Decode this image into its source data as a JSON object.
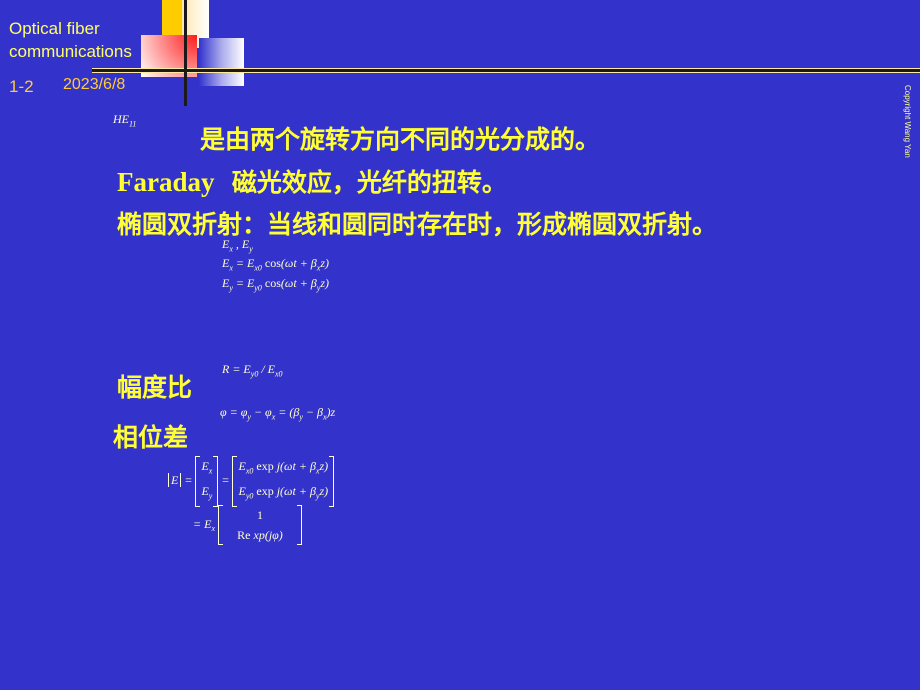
{
  "header": {
    "title_line1": "Optical fiber",
    "title_line2": "communications",
    "slide_number": "1-2",
    "date": "2023/6/8",
    "copyright": "Copyright Wang Yan"
  },
  "content": {
    "mode_label": "HE",
    "mode_sub": "11",
    "line1": "是由两个旋转方向不同的光分成的。",
    "line2_en": "Faraday",
    "line2_cn": "磁光效应，光纤的扭转。",
    "line3": "椭圆双折射：当线和圆同时存在时，形成椭圆双折射。",
    "eq_components": "Ex , Ey",
    "eq_ex": "Ex = Ex0 cos(ωt + βx z)",
    "eq_ey": "Ey = Ey0 cos(ωt + βy z)",
    "amplitude_ratio_label": "幅度比",
    "amplitude_ratio_eq": "R = Ey0 / Ex0",
    "phase_diff_label": "相位差",
    "phase_diff_eq": "φ = φy − φx = (βy − βx)z",
    "matrix_eq_line1": "[E] = [Ex ; Ey] = [Ex0 exp j(ωt + βx z) ; Ey0 exp j(ωt + βy z)]",
    "matrix_eq_line2": "= Ex [1 ; Re xp(jφ)]",
    "matrix_row_one": "1",
    "matrix_row_rexp": "Re xp(jφ)"
  },
  "colors": {
    "background": "#3333cc",
    "heading_text": "#ffff33",
    "header_text": "#ffcc33"
  }
}
